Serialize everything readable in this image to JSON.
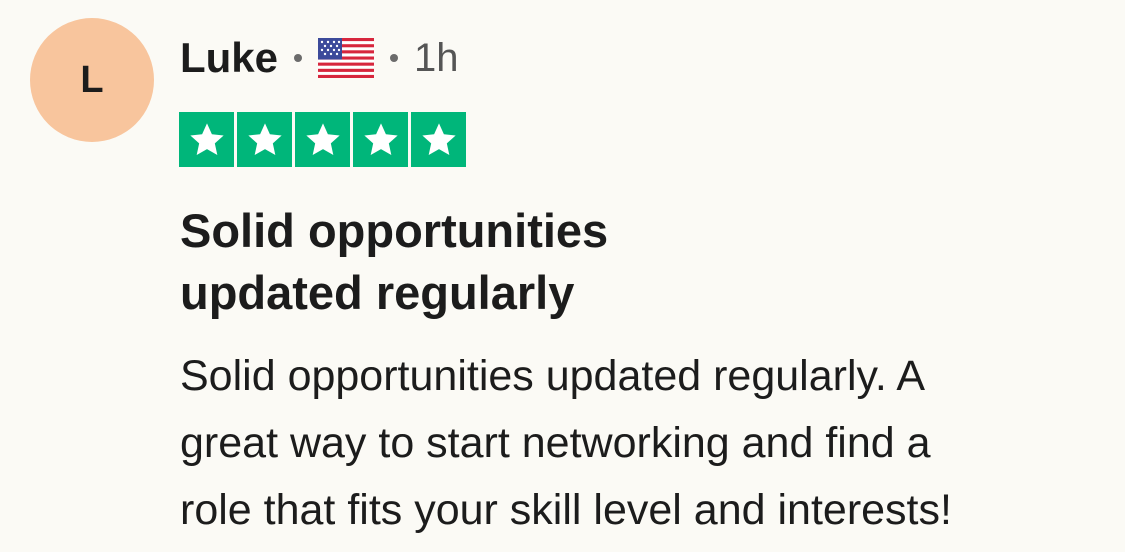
{
  "review": {
    "avatar_initial": "L",
    "author": "Luke",
    "country_flag_icon": "us-flag-icon",
    "time": "1h",
    "rating": 5,
    "rating_max": 5,
    "star_color": "#00b67a",
    "title_lines": [
      "Solid opportunities",
      "updated regularly"
    ],
    "body_lines": [
      "Solid opportunities updated regularly. A",
      "great way to start networking and find a",
      "role that fits your skill level and interests!"
    ]
  },
  "colors": {
    "background": "#fbfaf5",
    "avatar_bg": "#f8c59d",
    "text": "#1c1c1c"
  }
}
